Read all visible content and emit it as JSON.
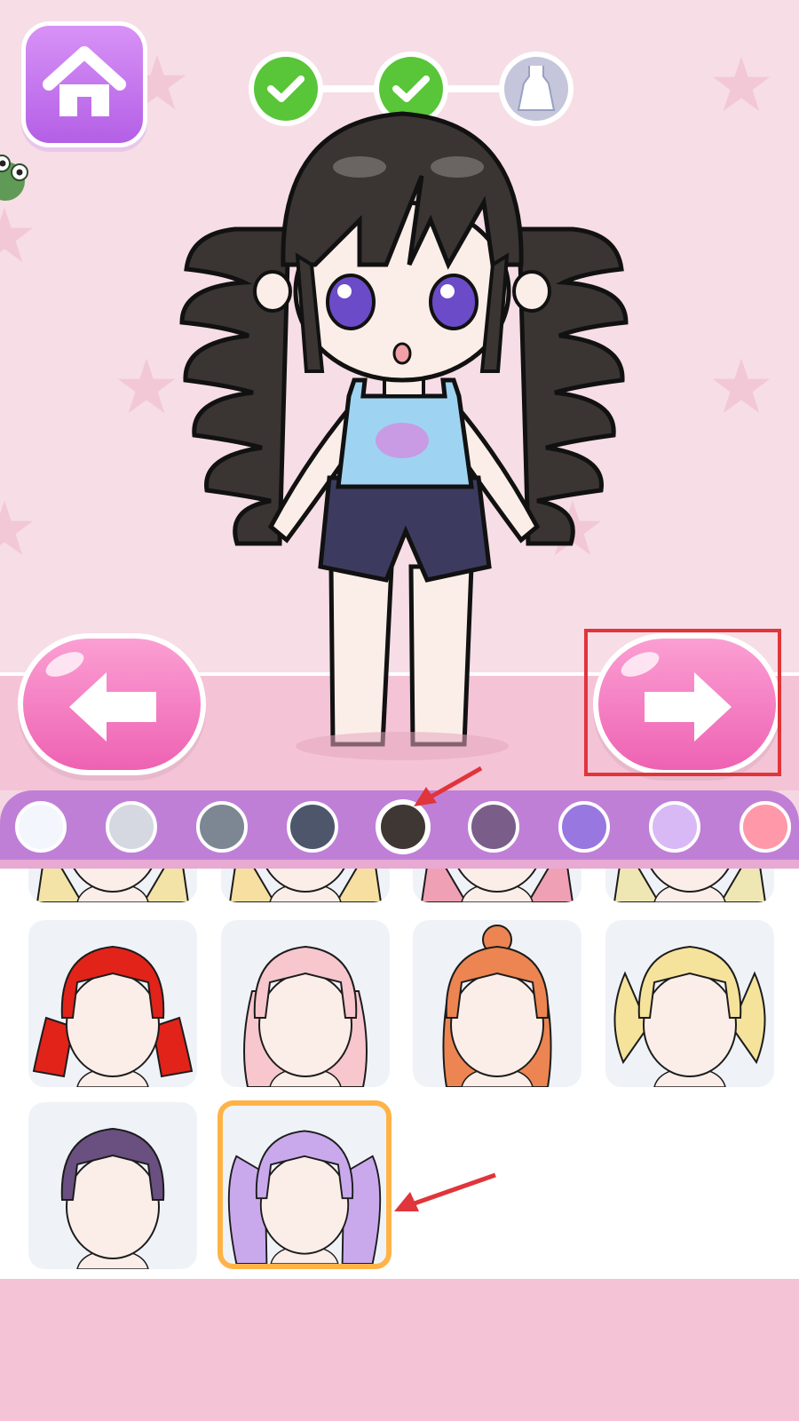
{
  "screen": {
    "name": "hair-selection"
  },
  "buttons": {
    "home_icon": "home-icon",
    "prev_icon": "arrow-left-icon",
    "next_icon": "arrow-right-icon"
  },
  "progress": {
    "steps": [
      {
        "state": "done",
        "icon": "checkmark-icon"
      },
      {
        "state": "done",
        "icon": "checkmark-icon"
      },
      {
        "state": "current",
        "icon": "dress-icon"
      }
    ]
  },
  "colors": {
    "selected_index": 4,
    "swatches": [
      "#f4f6fd",
      "#d5d8e0",
      "#7c8793",
      "#4e566b",
      "#3e3733",
      "#7a5d88",
      "#9877e0",
      "#d8b9f6",
      "#ff98a8"
    ]
  },
  "hair_options": {
    "selected_index": 9,
    "items": [
      {
        "color": "#f3e3a6",
        "partial": true
      },
      {
        "color": "#f6dfa0",
        "partial": true
      },
      {
        "color": "#f0a0b4",
        "partial": true
      },
      {
        "color": "#efe7b3",
        "partial": true
      },
      {
        "color": "#e2231a",
        "style": "twin-braids"
      },
      {
        "color": "#f7c7cd",
        "style": "long-wavy"
      },
      {
        "color": "#ec8551",
        "style": "bun"
      },
      {
        "color": "#f5e39c",
        "style": "pigtails"
      },
      {
        "color": "#6a4f81",
        "style": "short"
      },
      {
        "color": "#c9a9ec",
        "style": "drill-curls"
      }
    ]
  },
  "annotation_color": "#e0353a"
}
